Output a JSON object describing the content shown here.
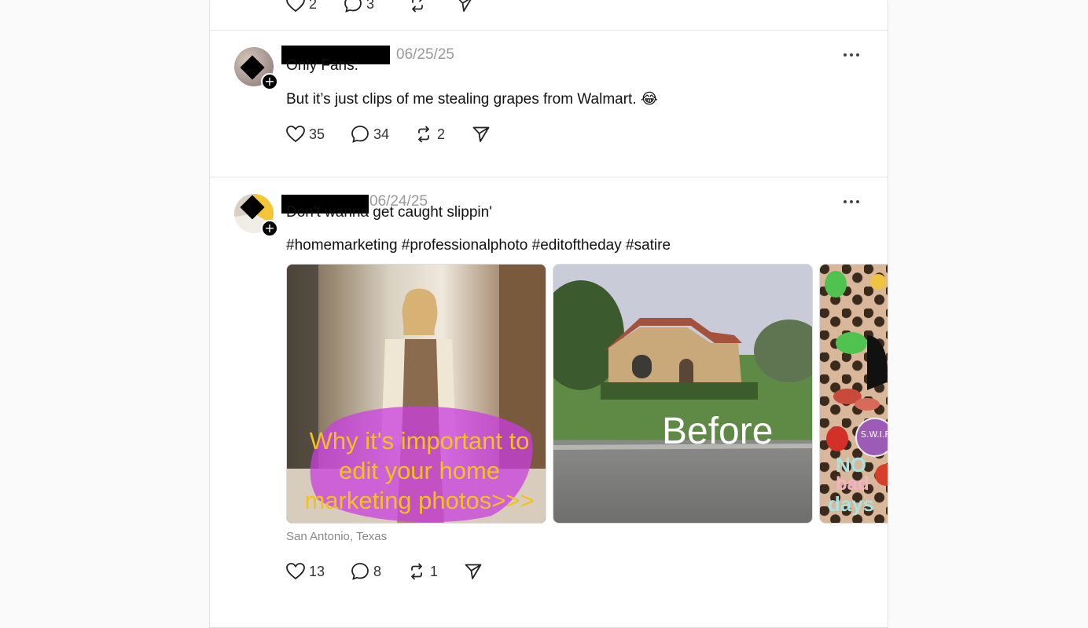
{
  "prev_post": {
    "likes": "2",
    "comments": "3"
  },
  "post1": {
    "date": "06/25/25",
    "line1": "Only Fans:",
    "line2": "But it’s just clips of me stealing grapes from Walmart. 😂",
    "likes": "35",
    "comments": "34",
    "reposts": "2"
  },
  "post2": {
    "date": "06/24/25",
    "line1": "Don't wanna get caught slippin'",
    "hashtags": "#homemarketing #professionalphoto #editoftheday #satire",
    "image1_caption": "Why it's important to edit your home marketing photos>>>",
    "image2_caption": "Before",
    "image3_text1": "NO",
    "image3_text2": "bad",
    "image3_text3": "days",
    "image3_badge": "S.W.I.F.T",
    "location": "San Antonio, Texas",
    "likes": "13",
    "comments": "8",
    "reposts": "1"
  },
  "icons": {
    "like": "heart-icon",
    "comment": "comment-icon",
    "repost": "repost-icon",
    "share": "send-icon",
    "more": "more-icon",
    "follow": "plus-icon"
  },
  "colors": {
    "caption_yellow": "#f2c21b",
    "caption_purple": "#c93ee0",
    "date_gray": "#999999"
  }
}
